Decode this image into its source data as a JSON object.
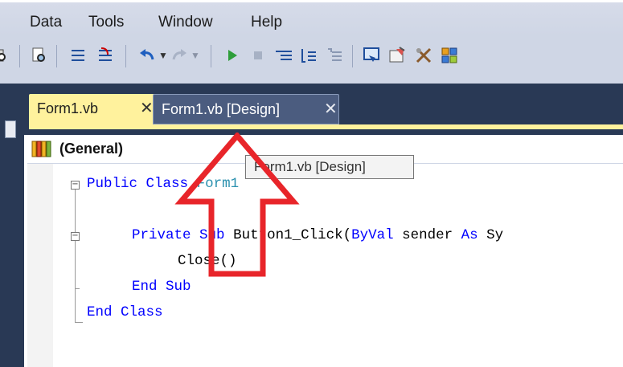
{
  "menu": {
    "items": [
      "Data",
      "Tools",
      "Window",
      "Help"
    ]
  },
  "toolbar": {
    "icons": [
      "find-icon",
      "comment-lines-icon",
      "uncomment-lines-icon",
      "undo-icon",
      "redo-icon",
      "start-debug-icon",
      "stop-icon",
      "step-into-icon",
      "step-over-icon",
      "step-out-icon",
      "solution-explorer-icon",
      "properties-icon",
      "toolbox-icon",
      "object-browser-icon"
    ]
  },
  "tabs": [
    {
      "label": "Form1.vb",
      "close": "✕",
      "active": true
    },
    {
      "label": "Form1.vb [Design]",
      "close": "✕",
      "active": false
    }
  ],
  "navigation": {
    "label": "(General)"
  },
  "tooltip": {
    "text": "Form1.vb [Design]"
  },
  "code": {
    "line1": {
      "kw1": "Public",
      "kw2": "Class",
      "name": "Form1"
    },
    "line2": {
      "kw1": "Private",
      "kw2": "Sub",
      "name": "Button1_Click(",
      "kw3": "ByVal",
      "param": " sender ",
      "kw4": "As",
      "type": " Sy"
    },
    "line3": {
      "text": "Close()"
    },
    "line4": {
      "kw1": "End",
      "kw2": "Sub"
    },
    "line5": {
      "kw1": "End",
      "kw2": "Class"
    }
  },
  "colors": {
    "active_tab": "#fff29d",
    "ide_dark": "#293955",
    "keyword": "#0000ff",
    "arrow": "#e8252a"
  }
}
